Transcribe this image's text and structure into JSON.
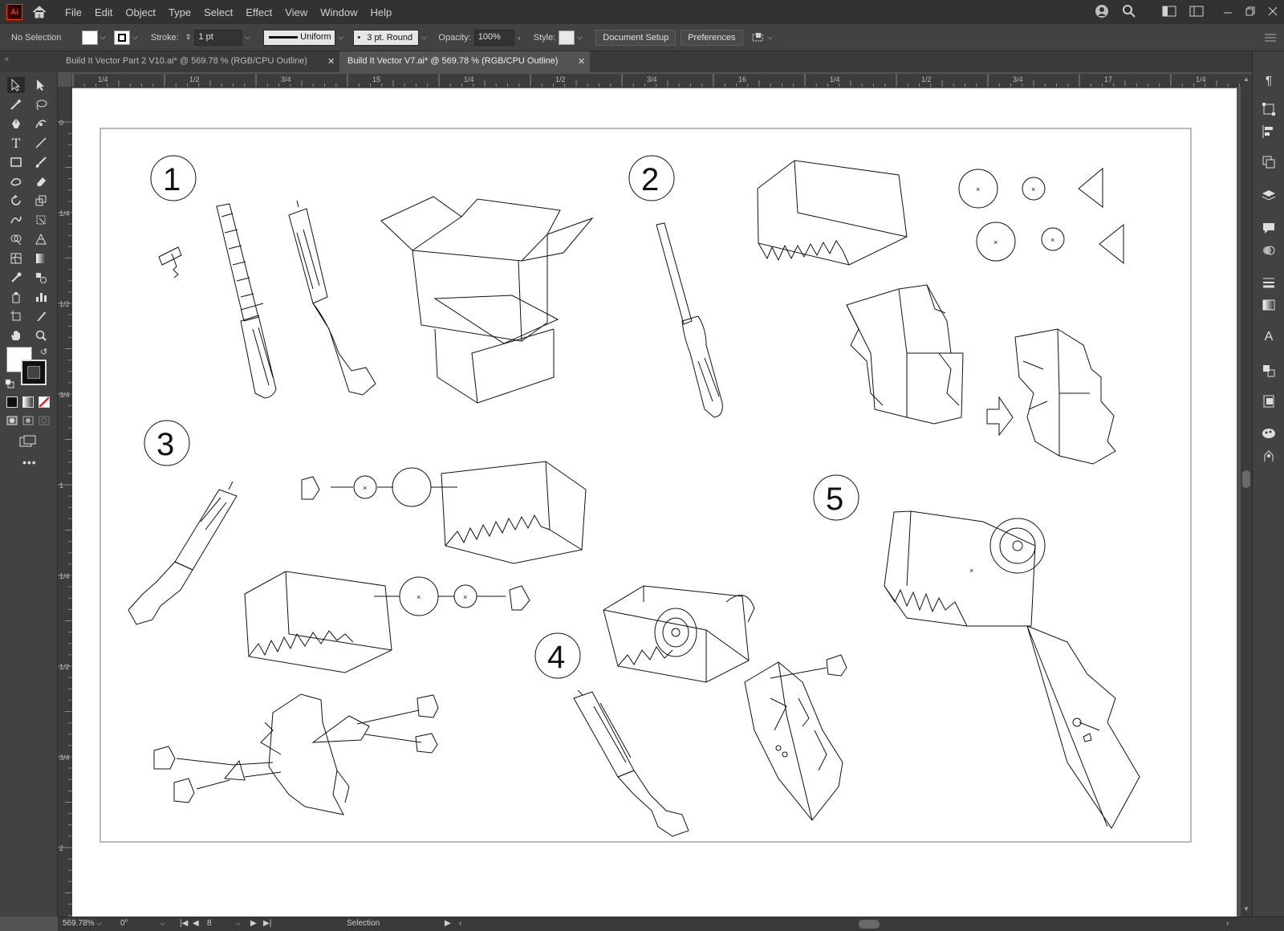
{
  "app": {
    "logo": "Ai"
  },
  "menu": [
    "File",
    "Edit",
    "Object",
    "Type",
    "Select",
    "Effect",
    "View",
    "Window",
    "Help"
  ],
  "control": {
    "selection": "No Selection",
    "stroke_label": "Stroke:",
    "stroke_value": "1 pt",
    "profile": "Uniform",
    "brush": "3 pt. Round",
    "opacity_label": "Opacity:",
    "opacity_value": "100%",
    "style_label": "Style:",
    "document_setup": "Document Setup",
    "preferences": "Preferences"
  },
  "tabs": [
    {
      "label": "Build It Vector Part 2 V10.ai* @ 569.78 % (RGB/CPU Outline)",
      "active": false
    },
    {
      "label": "Build It Vector V7.ai* @ 569.78 % (RGB/CPU Outline)",
      "active": true
    }
  ],
  "ruler_top": [
    "1/4",
    "1/2",
    "3/4",
    "15",
    "1/4",
    "1/2",
    "3/4",
    "16",
    "1/4",
    "1/2",
    "3/4",
    "17",
    "1/4"
  ],
  "ruler_left": [
    "0",
    "1/4",
    "1/2",
    "3/4",
    "1",
    "1/4",
    "1/2",
    "3/4",
    "2"
  ],
  "artwork": {
    "step_labels": [
      "1",
      "2",
      "3",
      "4",
      "5"
    ]
  },
  "status": {
    "zoom": "569.78%",
    "rotation": "0°",
    "artboard": "8",
    "tool": "Selection"
  }
}
